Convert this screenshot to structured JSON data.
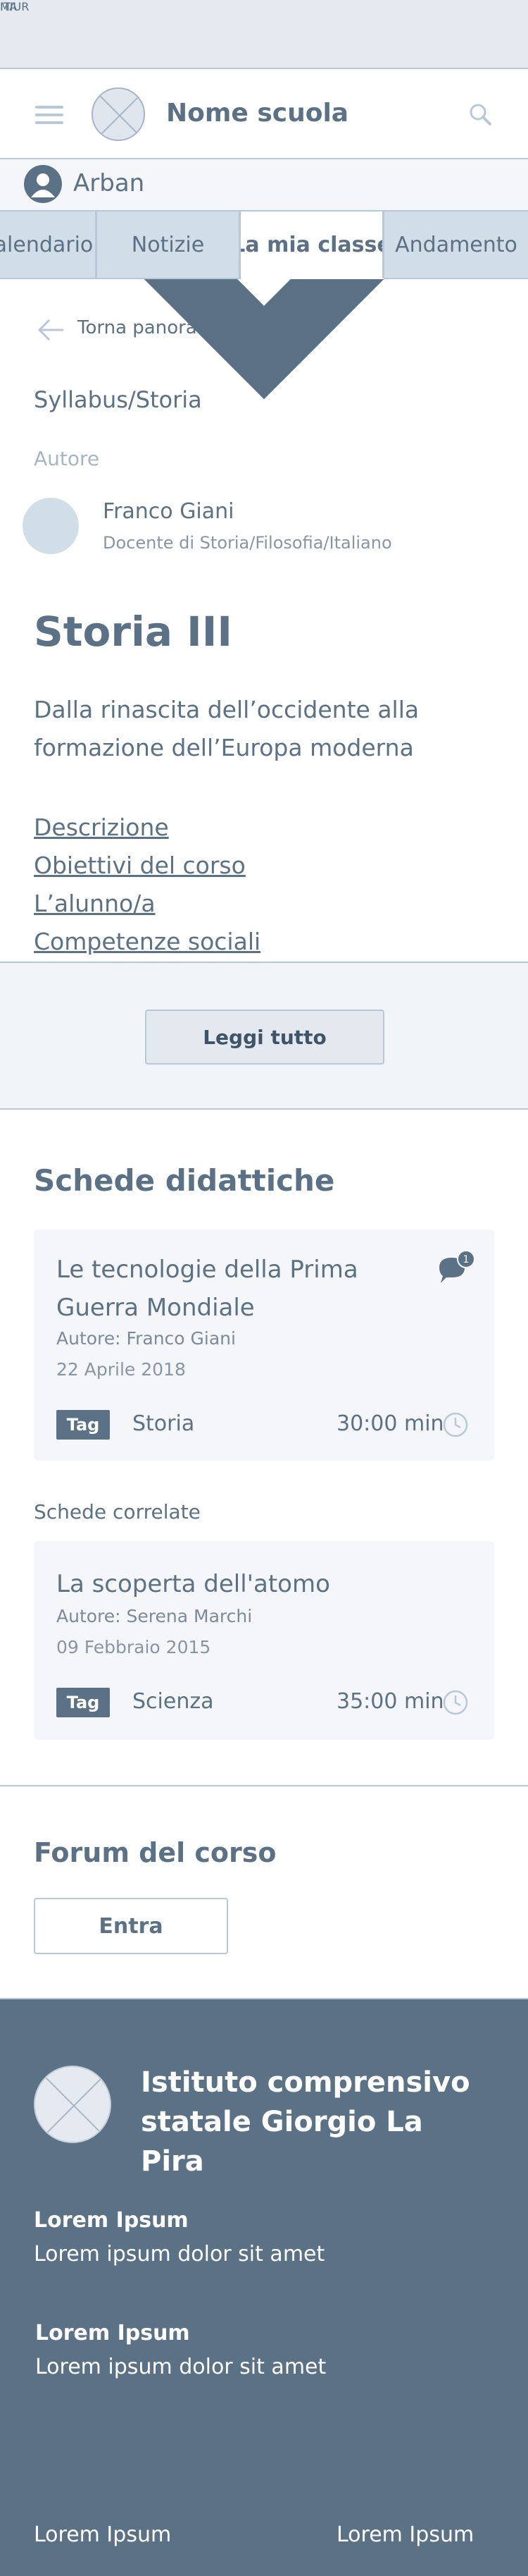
{
  "topbar": {
    "ministry": "MIUR",
    "language": "ITA"
  },
  "header": {
    "school_name": "Nome scuola"
  },
  "user": {
    "name": "Arban"
  },
  "tabs": [
    {
      "label": "Calendario"
    },
    {
      "label": "Notizie"
    },
    {
      "label": "La mia classe"
    },
    {
      "label": "Andamento"
    }
  ],
  "active_tab": "La mia classe",
  "back": {
    "label": "Torna panoramica classe"
  },
  "breadcrumb": "Syllabus/Storia",
  "author_section": {
    "label": "Autore",
    "name": "Franco Giani",
    "role": "Docente di Storia/Filosofia/Italiano"
  },
  "course": {
    "title": "Storia III",
    "subtitle": "Dalla rinascita dell’occidente alla formazione dell’Europa moderna",
    "links": [
      "Descrizione",
      "Obiettivi del corso",
      "L’alunno/a",
      "Competenze sociali"
    ],
    "read_more": "Leggi tutto"
  },
  "schede": {
    "title": "Schede didattiche",
    "cards": [
      {
        "title": "Le tecnologie della Prima Guerra Mondiale",
        "author_label": "Autore:",
        "author": "Franco Giani",
        "date": "22 Aprile 2018",
        "tag_label": "Tag",
        "tag": "Storia",
        "duration": "30:00 min",
        "comments": "1"
      }
    ],
    "related_label": "Schede correlate",
    "related": [
      {
        "title": "La scoperta dell'atomo",
        "author_label": "Autore:",
        "author": "Serena Marchi",
        "date": "09 Febbraio 2015",
        "tag_label": "Tag",
        "tag": "Scienza",
        "duration": "35:00 min"
      }
    ]
  },
  "forum": {
    "title": "Forum del corso",
    "button": "Entra"
  },
  "footer": {
    "institute": "Istituto comprensivo statale Giorgio La Pira",
    "blocks": [
      {
        "title": "Lorem Ipsum",
        "text": "Lorem ipsum dolor sit amet"
      },
      {
        "title": "Lorem Ipsum",
        "text": "Lorem ipsum dolor sit amet"
      }
    ],
    "bottom_links": [
      "Lorem Ipsum",
      "Lorem Ipsum"
    ]
  },
  "colors": {
    "primary": "#5b7186",
    "light_bg": "#e5eaf1",
    "tab_bg": "#d1dde7",
    "border": "#b9c8d8"
  },
  "icons": {
    "dropdown": "chevron-down-icon",
    "menu": "hamburger-icon",
    "search": "search-icon",
    "user": "user-icon",
    "back": "arrow-left-icon",
    "comment": "comment-icon",
    "clock": "clock-icon"
  }
}
